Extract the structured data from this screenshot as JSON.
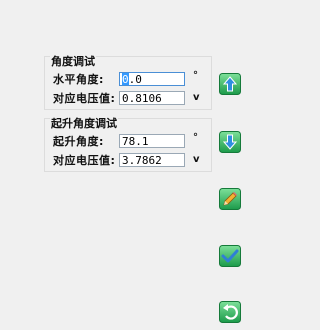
{
  "group1": {
    "title": "角度调试",
    "row1": {
      "label": "水平角度:",
      "value_first": "0",
      "value_rest": ".0",
      "unit": "°"
    },
    "row2": {
      "label": "对应电压值:",
      "value": "0.8106",
      "unit": "v"
    }
  },
  "group2": {
    "title": "起升角度调试",
    "row1": {
      "label": "起升角度:",
      "value": "78.1",
      "unit": "°"
    },
    "row2": {
      "label": "对应电压值:",
      "value": "3.7862",
      "unit": "v"
    }
  },
  "buttons": {
    "up": "arrow-up-icon",
    "down": "arrow-down-icon",
    "edit": "pencil-icon",
    "confirm": "checkmark-icon",
    "back": "undo-icon"
  }
}
